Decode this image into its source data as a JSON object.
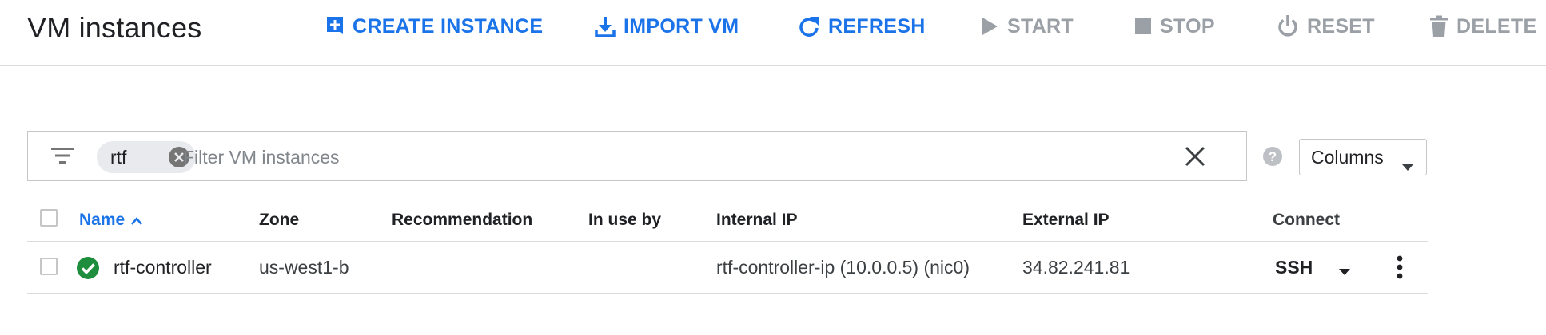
{
  "header": {
    "title": "VM instances",
    "toolbar": [
      {
        "label": "CREATE INSTANCE",
        "icon": "add-box-icon",
        "state": "enabled"
      },
      {
        "label": "IMPORT VM",
        "icon": "download-icon",
        "state": "enabled"
      },
      {
        "label": "REFRESH",
        "icon": "refresh-icon",
        "state": "enabled"
      },
      {
        "label": "START",
        "icon": "play-icon",
        "state": "disabled"
      },
      {
        "label": "STOP",
        "icon": "stop-icon",
        "state": "disabled"
      },
      {
        "label": "RESET",
        "icon": "power-icon",
        "state": "disabled"
      },
      {
        "label": "DELETE",
        "icon": "trash-icon",
        "state": "disabled"
      }
    ]
  },
  "filter": {
    "chip_label": "rtf",
    "placeholder": "Filter VM instances",
    "value": ""
  },
  "columns_button": {
    "label": "Columns"
  },
  "table": {
    "headers": {
      "name": "Name",
      "zone": "Zone",
      "recommendation": "Recommendation",
      "in_use_by": "In use by",
      "internal_ip": "Internal IP",
      "external_ip": "External IP",
      "connect": "Connect"
    },
    "sort": {
      "column": "name",
      "direction": "ascending"
    },
    "rows": [
      {
        "status": "running",
        "name": "rtf-controller",
        "zone": "us-west1-b",
        "recommendation": "",
        "in_use_by": "",
        "internal_ip": "rtf-controller-ip (10.0.0.5) (nic0)",
        "external_ip": "34.82.241.81",
        "connect": "SSH"
      }
    ]
  },
  "colors": {
    "accent": "#1a73e8",
    "disabled": "#9aa0a6",
    "status_ok": "#1e8e3e",
    "border": "#dadce0"
  }
}
